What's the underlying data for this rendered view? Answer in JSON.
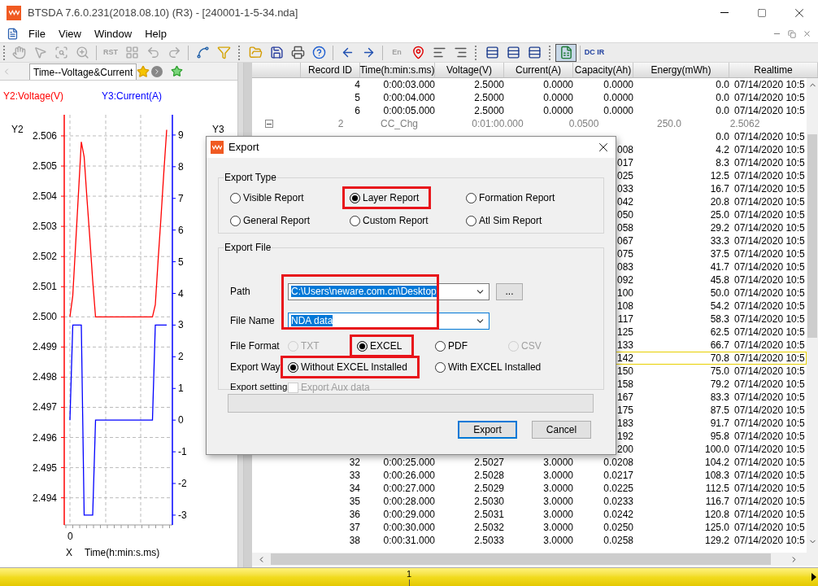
{
  "window": {
    "title": "BTSDA 7.6.0.231(2018.08.10) (R3) - [240001-1-5-34.nda]"
  },
  "menu": [
    "File",
    "View",
    "Window",
    "Help"
  ],
  "toolbar": [
    {
      "kind": "hand",
      "disabled": true,
      "pressed": false
    },
    {
      "kind": "pointer",
      "disabled": true,
      "pressed": false
    },
    {
      "kind": "zoom-box",
      "disabled": true,
      "pressed": false
    },
    {
      "kind": "zoom",
      "disabled": true,
      "pressed": false
    },
    {
      "kind": "separator"
    },
    {
      "kind": "text",
      "label": "RST",
      "disabled": true,
      "pressed": false
    },
    {
      "kind": "grid",
      "disabled": true,
      "pressed": false
    },
    {
      "kind": "undo",
      "disabled": true,
      "pressed": false
    },
    {
      "kind": "redo",
      "disabled": true,
      "pressed": false
    },
    {
      "kind": "separator"
    },
    {
      "kind": "curve",
      "disabled": false,
      "pressed": false
    },
    {
      "kind": "filter",
      "disabled": false,
      "pressed": false
    },
    {
      "kind": "gripper"
    },
    {
      "kind": "open",
      "disabled": false,
      "pressed": false
    },
    {
      "kind": "save",
      "disabled": false,
      "pressed": false
    },
    {
      "kind": "print",
      "disabled": false,
      "pressed": false
    },
    {
      "kind": "help",
      "disabled": false,
      "pressed": false
    },
    {
      "kind": "separator"
    },
    {
      "kind": "back",
      "disabled": false,
      "pressed": false
    },
    {
      "kind": "forward",
      "disabled": false,
      "pressed": false
    },
    {
      "kind": "separator"
    },
    {
      "kind": "text",
      "label": "En",
      "disabled": true,
      "pressed": false
    },
    {
      "kind": "marker",
      "disabled": false,
      "pressed": false
    },
    {
      "kind": "align-left",
      "disabled": false,
      "pressed": false
    },
    {
      "kind": "align-right",
      "disabled": false,
      "pressed": false
    },
    {
      "kind": "gripper"
    },
    {
      "kind": "table",
      "disabled": false,
      "pressed": false
    },
    {
      "kind": "table",
      "disabled": false,
      "pressed": false
    },
    {
      "kind": "table",
      "disabled": false,
      "pressed": false
    },
    {
      "kind": "gripper"
    },
    {
      "kind": "excel",
      "disabled": false,
      "pressed": true
    },
    {
      "kind": "separator"
    },
    {
      "kind": "text",
      "label": "DC IR",
      "disabled": false,
      "pressed": false
    }
  ],
  "left_pane": {
    "tab": {
      "label": "Time--Voltage&Current",
      "selected": true
    },
    "voltage_chart": {
      "chart_data": {
        "type": "line",
        "grid": true,
        "xlabel": "Time(h:min:s.ms)",
        "ylabel": "Y2",
        "ylim": [
          2.4931,
          2.5067
        ],
        "yticks": [
          {
            "value": 2.494,
            "label": "2.494"
          },
          {
            "value": 2.495,
            "label": "2.495"
          },
          {
            "value": 2.496,
            "label": "2.496"
          },
          {
            "value": 2.497,
            "label": "2.497"
          },
          {
            "value": 2.498,
            "label": "2.498"
          },
          {
            "value": 2.499,
            "label": "2.499"
          },
          {
            "value": 2.5,
            "label": "2.500"
          },
          {
            "value": 2.501,
            "label": "2.501"
          },
          {
            "value": 2.502,
            "label": "2.502"
          },
          {
            "value": 2.503,
            "label": "2.503"
          },
          {
            "value": 2.504,
            "label": "2.504"
          },
          {
            "value": 2.505,
            "label": "2.505"
          },
          {
            "value": 2.506,
            "label": "2.506"
          }
        ],
        "annotations": [
          {
            "text": "0"
          },
          {
            "text": "X"
          }
        ],
        "series": [
          {
            "name": "Y2:Voltage(V)",
            "color": "#ff0000",
            "values": [
              2.5,
              2.5007,
              2.5024,
              2.5041,
              2.5058,
              2.5053,
              2.5039,
              2.5026,
              2.5012,
              2.5,
              2.5,
              2.5,
              2.5,
              2.5,
              2.5,
              2.5,
              2.5,
              2.5,
              2.5,
              2.5,
              2.5,
              2.5,
              2.5,
              2.5,
              2.5,
              2.5,
              2.5,
              2.5,
              2.5,
              2.5,
              2.5004,
              2.5019,
              2.5033,
              2.5048,
              2.5062
            ]
          }
        ]
      }
    },
    "current_chart": {
      "chart_data": {
        "type": "line",
        "ylabel": "Y3",
        "ylim": [
          -3.31,
          9.64
        ],
        "yticks": [
          {
            "value": -3,
            "label": "-3"
          },
          {
            "value": -2,
            "label": "-2"
          },
          {
            "value": -1,
            "label": "-1"
          },
          {
            "value": 0,
            "label": "0"
          },
          {
            "value": 1,
            "label": "1"
          },
          {
            "value": 2,
            "label": "2"
          },
          {
            "value": 3,
            "label": "3"
          },
          {
            "value": 4,
            "label": "4"
          },
          {
            "value": 5,
            "label": "5"
          },
          {
            "value": 6,
            "label": "6"
          },
          {
            "value": 7,
            "label": "7"
          },
          {
            "value": 8,
            "label": "8"
          },
          {
            "value": 9,
            "label": "9"
          }
        ],
        "series": [
          {
            "name": "Y3:Current(A)",
            "color": "#0000ff",
            "values": [
              0,
              3,
              3,
              3,
              3,
              -3,
              -3,
              -3,
              -3,
              0,
              0,
              0,
              0,
              0,
              0,
              0,
              0,
              0,
              0,
              0,
              0,
              0,
              0,
              0,
              0,
              0,
              0,
              0,
              0,
              0,
              3,
              3,
              3,
              3,
              3
            ]
          }
        ]
      }
    }
  },
  "table": {
    "columns": [
      "Record ID",
      "Time(h:min:s.ms)",
      "Voltage(V)",
      "Current(A)",
      "Capacity(Ah)",
      "Energy(mWh)",
      "Realtime"
    ],
    "rows": [
      {
        "kind": "record",
        "id": "4",
        "time": "0:00:03.000",
        "voltage": "2.5000",
        "current": "0.0000",
        "capacity": "0.0000",
        "energy": "0.0",
        "realtime": "07/14/2020 10:5",
        "selected": false
      },
      {
        "kind": "record",
        "id": "5",
        "time": "0:00:04.000",
        "voltage": "2.5000",
        "current": "0.0000",
        "capacity": "0.0000",
        "energy": "0.0",
        "realtime": "07/14/2020 10:5",
        "selected": false
      },
      {
        "kind": "record",
        "id": "6",
        "time": "0:00:05.000",
        "voltage": "2.5000",
        "current": "0.0000",
        "capacity": "0.0000",
        "energy": "0.0",
        "realtime": "07/14/2020 10:5",
        "selected": false
      },
      {
        "kind": "group",
        "expanded": true,
        "id": "2",
        "step": "CC_Chg",
        "duration": "0:01:00.000",
        "column_4": "0.0500",
        "column_5": "250.0",
        "column_6": "2.5062",
        "selected": false
      },
      {
        "kind": "record",
        "energy": "0.0",
        "realtime": "07/14/2020 10:5",
        "selected": false
      },
      {
        "kind": "record",
        "capacity": "008",
        "energy": "4.2",
        "realtime": "07/14/2020 10:5",
        "selected": false
      },
      {
        "kind": "record",
        "capacity": "017",
        "energy": "8.3",
        "realtime": "07/14/2020 10:5",
        "selected": false
      },
      {
        "kind": "record",
        "capacity": "025",
        "energy": "12.5",
        "realtime": "07/14/2020 10:5",
        "selected": false
      },
      {
        "kind": "record",
        "capacity": "033",
        "energy": "16.7",
        "realtime": "07/14/2020 10:5",
        "selected": false
      },
      {
        "kind": "record",
        "capacity": "042",
        "energy": "20.8",
        "realtime": "07/14/2020 10:5",
        "selected": false
      },
      {
        "kind": "record",
        "capacity": "050",
        "energy": "25.0",
        "realtime": "07/14/2020 10:5",
        "selected": false
      },
      {
        "kind": "record",
        "capacity": "058",
        "energy": "29.2",
        "realtime": "07/14/2020 10:5",
        "selected": false
      },
      {
        "kind": "record",
        "capacity": "067",
        "energy": "33.3",
        "realtime": "07/14/2020 10:5",
        "selected": false
      },
      {
        "kind": "record",
        "capacity": "075",
        "energy": "37.5",
        "realtime": "07/14/2020 10:5",
        "selected": false
      },
      {
        "kind": "record",
        "capacity": "083",
        "energy": "41.7",
        "realtime": "07/14/2020 10:5",
        "selected": false
      },
      {
        "kind": "record",
        "capacity": "092",
        "energy": "45.8",
        "realtime": "07/14/2020 10:5",
        "selected": false
      },
      {
        "kind": "record",
        "capacity": "100",
        "energy": "50.0",
        "realtime": "07/14/2020 10:5",
        "selected": false
      },
      {
        "kind": "record",
        "capacity": "108",
        "energy": "54.2",
        "realtime": "07/14/2020 10:5",
        "selected": false
      },
      {
        "kind": "record",
        "capacity": "117",
        "energy": "58.3",
        "realtime": "07/14/2020 10:5",
        "selected": false
      },
      {
        "kind": "record",
        "capacity": "125",
        "energy": "62.5",
        "realtime": "07/14/2020 10:5",
        "selected": false
      },
      {
        "kind": "record",
        "capacity": "133",
        "energy": "66.7",
        "realtime": "07/14/2020 10:5",
        "selected": false
      },
      {
        "kind": "record",
        "capacity": "142",
        "energy": "70.8",
        "realtime": "07/14/2020 10:5",
        "selected": true
      },
      {
        "kind": "record",
        "capacity": "150",
        "energy": "75.0",
        "realtime": "07/14/2020 10:5",
        "selected": false
      },
      {
        "kind": "record",
        "capacity": "158",
        "energy": "79.2",
        "realtime": "07/14/2020 10:5",
        "selected": false
      },
      {
        "kind": "record",
        "capacity": "167",
        "energy": "83.3",
        "realtime": "07/14/2020 10:5",
        "selected": false
      },
      {
        "kind": "record",
        "capacity": "175",
        "energy": "87.5",
        "realtime": "07/14/2020 10:5",
        "selected": false
      },
      {
        "kind": "record",
        "capacity": "183",
        "energy": "91.7",
        "realtime": "07/14/2020 10:5",
        "selected": false
      },
      {
        "kind": "record",
        "capacity": "192",
        "energy": "95.8",
        "realtime": "07/14/2020 10:5",
        "selected": false
      },
      {
        "kind": "record",
        "capacity": "200",
        "energy": "100.0",
        "realtime": "07/14/2020 10:5",
        "selected": false
      },
      {
        "kind": "record",
        "id": "32",
        "time": "0:00:25.000",
        "voltage": "2.5027",
        "current": "3.0000",
        "capacity": "0.0208",
        "energy": "104.2",
        "realtime": "07/14/2020 10:5",
        "selected": false
      },
      {
        "kind": "record",
        "id": "33",
        "time": "0:00:26.000",
        "voltage": "2.5028",
        "current": "3.0000",
        "capacity": "0.0217",
        "energy": "108.3",
        "realtime": "07/14/2020 10:5",
        "selected": false
      },
      {
        "kind": "record",
        "id": "34",
        "time": "0:00:27.000",
        "voltage": "2.5029",
        "current": "3.0000",
        "capacity": "0.0225",
        "energy": "112.5",
        "realtime": "07/14/2020 10:5",
        "selected": false
      },
      {
        "kind": "record",
        "id": "35",
        "time": "0:00:28.000",
        "voltage": "2.5030",
        "current": "3.0000",
        "capacity": "0.0233",
        "energy": "116.7",
        "realtime": "07/14/2020 10:5",
        "selected": false
      },
      {
        "kind": "record",
        "id": "36",
        "time": "0:00:29.000",
        "voltage": "2.5031",
        "current": "3.0000",
        "capacity": "0.0242",
        "energy": "120.8",
        "realtime": "07/14/2020 10:5",
        "selected": false
      },
      {
        "kind": "record",
        "id": "37",
        "time": "0:00:30.000",
        "voltage": "2.5032",
        "current": "3.0000",
        "capacity": "0.0250",
        "energy": "125.0",
        "realtime": "07/14/2020 10:5",
        "selected": false
      },
      {
        "kind": "record",
        "id": "38",
        "time": "0:00:31.000",
        "voltage": "2.5033",
        "current": "3.0000",
        "capacity": "0.0258",
        "energy": "129.2",
        "realtime": "07/14/2020 10:5",
        "selected": false
      }
    ]
  },
  "bottom_bar": {
    "label": "1"
  },
  "dialog": {
    "title": "Export",
    "export_type": {
      "legend": "Export Type",
      "options": [
        {
          "label": "Visible Report",
          "selected": false,
          "highlighted": false
        },
        {
          "label": "Layer Report",
          "selected": true,
          "highlighted": true
        },
        {
          "label": "Formation Report",
          "selected": false,
          "highlighted": false
        },
        {
          "label": "General Report",
          "selected": false,
          "highlighted": false
        },
        {
          "label": "Custom Report",
          "selected": false,
          "highlighted": false
        },
        {
          "label": "Atl Sim Report",
          "selected": false,
          "highlighted": false
        }
      ]
    },
    "export_file": {
      "legend": "Export File",
      "fields_highlighted": true,
      "path": {
        "label": "Path",
        "value": "C:\\Users\\neware.com.cn\\Desktop",
        "text_selected": true,
        "focused": false
      },
      "browse_button": "...",
      "file_name": {
        "label": "File Name",
        "value": "NDA data",
        "text_selected": true,
        "focused": true
      },
      "file_format": {
        "label": "File Format",
        "options": [
          {
            "label": "TXT",
            "selected": false,
            "disabled": true,
            "highlighted": false
          },
          {
            "label": "EXCEL",
            "selected": true,
            "disabled": false,
            "highlighted": true
          },
          {
            "label": "PDF",
            "selected": false,
            "disabled": false,
            "highlighted": false
          },
          {
            "label": "CSV",
            "selected": false,
            "disabled": true,
            "highlighted": false
          }
        ]
      },
      "export_way": {
        "label": "Export Way",
        "options": [
          {
            "label": "Without EXCEL Installed",
            "selected": true,
            "highlighted": true
          },
          {
            "label": "With EXCEL Installed",
            "selected": false,
            "highlighted": false
          }
        ]
      },
      "export_setting": {
        "label": "Export setting",
        "checkbox": {
          "label": "Export Aux data",
          "checked": false,
          "disabled": true
        }
      }
    },
    "progress": {
      "level": 0
    },
    "buttons": [
      "Export",
      "Cancel"
    ]
  }
}
